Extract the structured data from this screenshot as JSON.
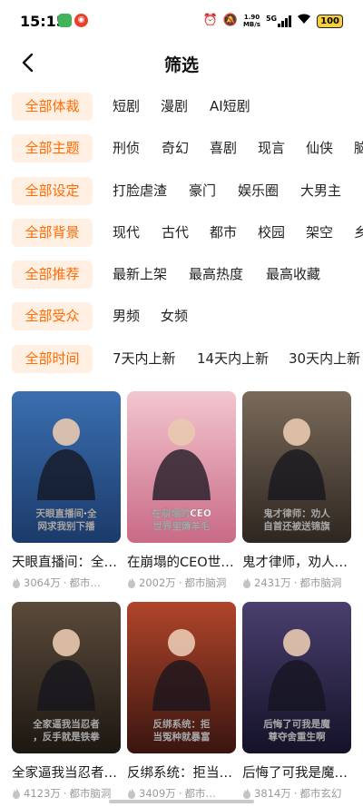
{
  "status_bar": {
    "time": "15:15",
    "speed_value": "1.90",
    "speed_unit": "MB/s",
    "network": "5G",
    "battery": "100"
  },
  "header": {
    "title": "筛选"
  },
  "filters": [
    {
      "active": "全部体裁",
      "options": [
        "短剧",
        "漫剧",
        "AI短剧"
      ]
    },
    {
      "active": "全部主题",
      "options": [
        "刑侦",
        "奇幻",
        "喜剧",
        "现言",
        "仙侠",
        "脑"
      ]
    },
    {
      "active": "全部设定",
      "options": [
        "打脸虐渣",
        "豪门",
        "娱乐圈",
        "大男主"
      ]
    },
    {
      "active": "全部背景",
      "options": [
        "现代",
        "古代",
        "都市",
        "校园",
        "架空",
        "乡"
      ]
    },
    {
      "active": "全部推荐",
      "options": [
        "最新上架",
        "最高热度",
        "最高收藏"
      ]
    },
    {
      "active": "全部受众",
      "options": [
        "男频",
        "女频"
      ]
    },
    {
      "active": "全部时间",
      "options": [
        "7天内上新",
        "14天内上新",
        "30天内上新"
      ]
    }
  ],
  "cards": [
    {
      "title": "天眼直播间：全网求我别下播",
      "poster_text": "天眼直播间·全网求我别下播",
      "views": "3064万",
      "genre": "都市…",
      "colors": [
        "#3b6fb0",
        "#1b3a6b"
      ]
    },
    {
      "title": "在崩塌的CEO世界里薅羊毛",
      "poster_text": "在崩塌的CEO世界里薅羊毛",
      "views": "2002万",
      "genre": "都市脑洞",
      "colors": [
        "#f3c6cf",
        "#c96a86"
      ]
    },
    {
      "title": "鬼才律师，劝人自首还被送锦旗",
      "poster_text": "鬼才律师：劝人自首还被送锦旗",
      "views": "2431万",
      "genre": "都市脑洞",
      "colors": [
        "#7a6a5a",
        "#2e2620"
      ]
    },
    {
      "title": "全家逼我当忍者，反手就是铁拳",
      "poster_text": "全家逼我当忍者，反手就是铁拳",
      "views": "4123万",
      "genre": "都市脑洞",
      "colors": [
        "#5a4a3a",
        "#1d1712"
      ]
    },
    {
      "title": "反绑系统：拒当冤种就暴富",
      "poster_text": "反绑系统：拒当冤种就暴富",
      "views": "3409万",
      "genre": "都市…",
      "colors": [
        "#b0452a",
        "#3a1510"
      ]
    },
    {
      "title": "后悔了可我是魔尊夺舍重生啊",
      "poster_text": "后悔了可我是魔尊夺舍重生啊",
      "views": "3814万",
      "genre": "都市玄幻",
      "colors": [
        "#4a3f6e",
        "#141228"
      ]
    }
  ],
  "accent_color": "#ff6a00",
  "chip_bg_color": "#fff0e3"
}
